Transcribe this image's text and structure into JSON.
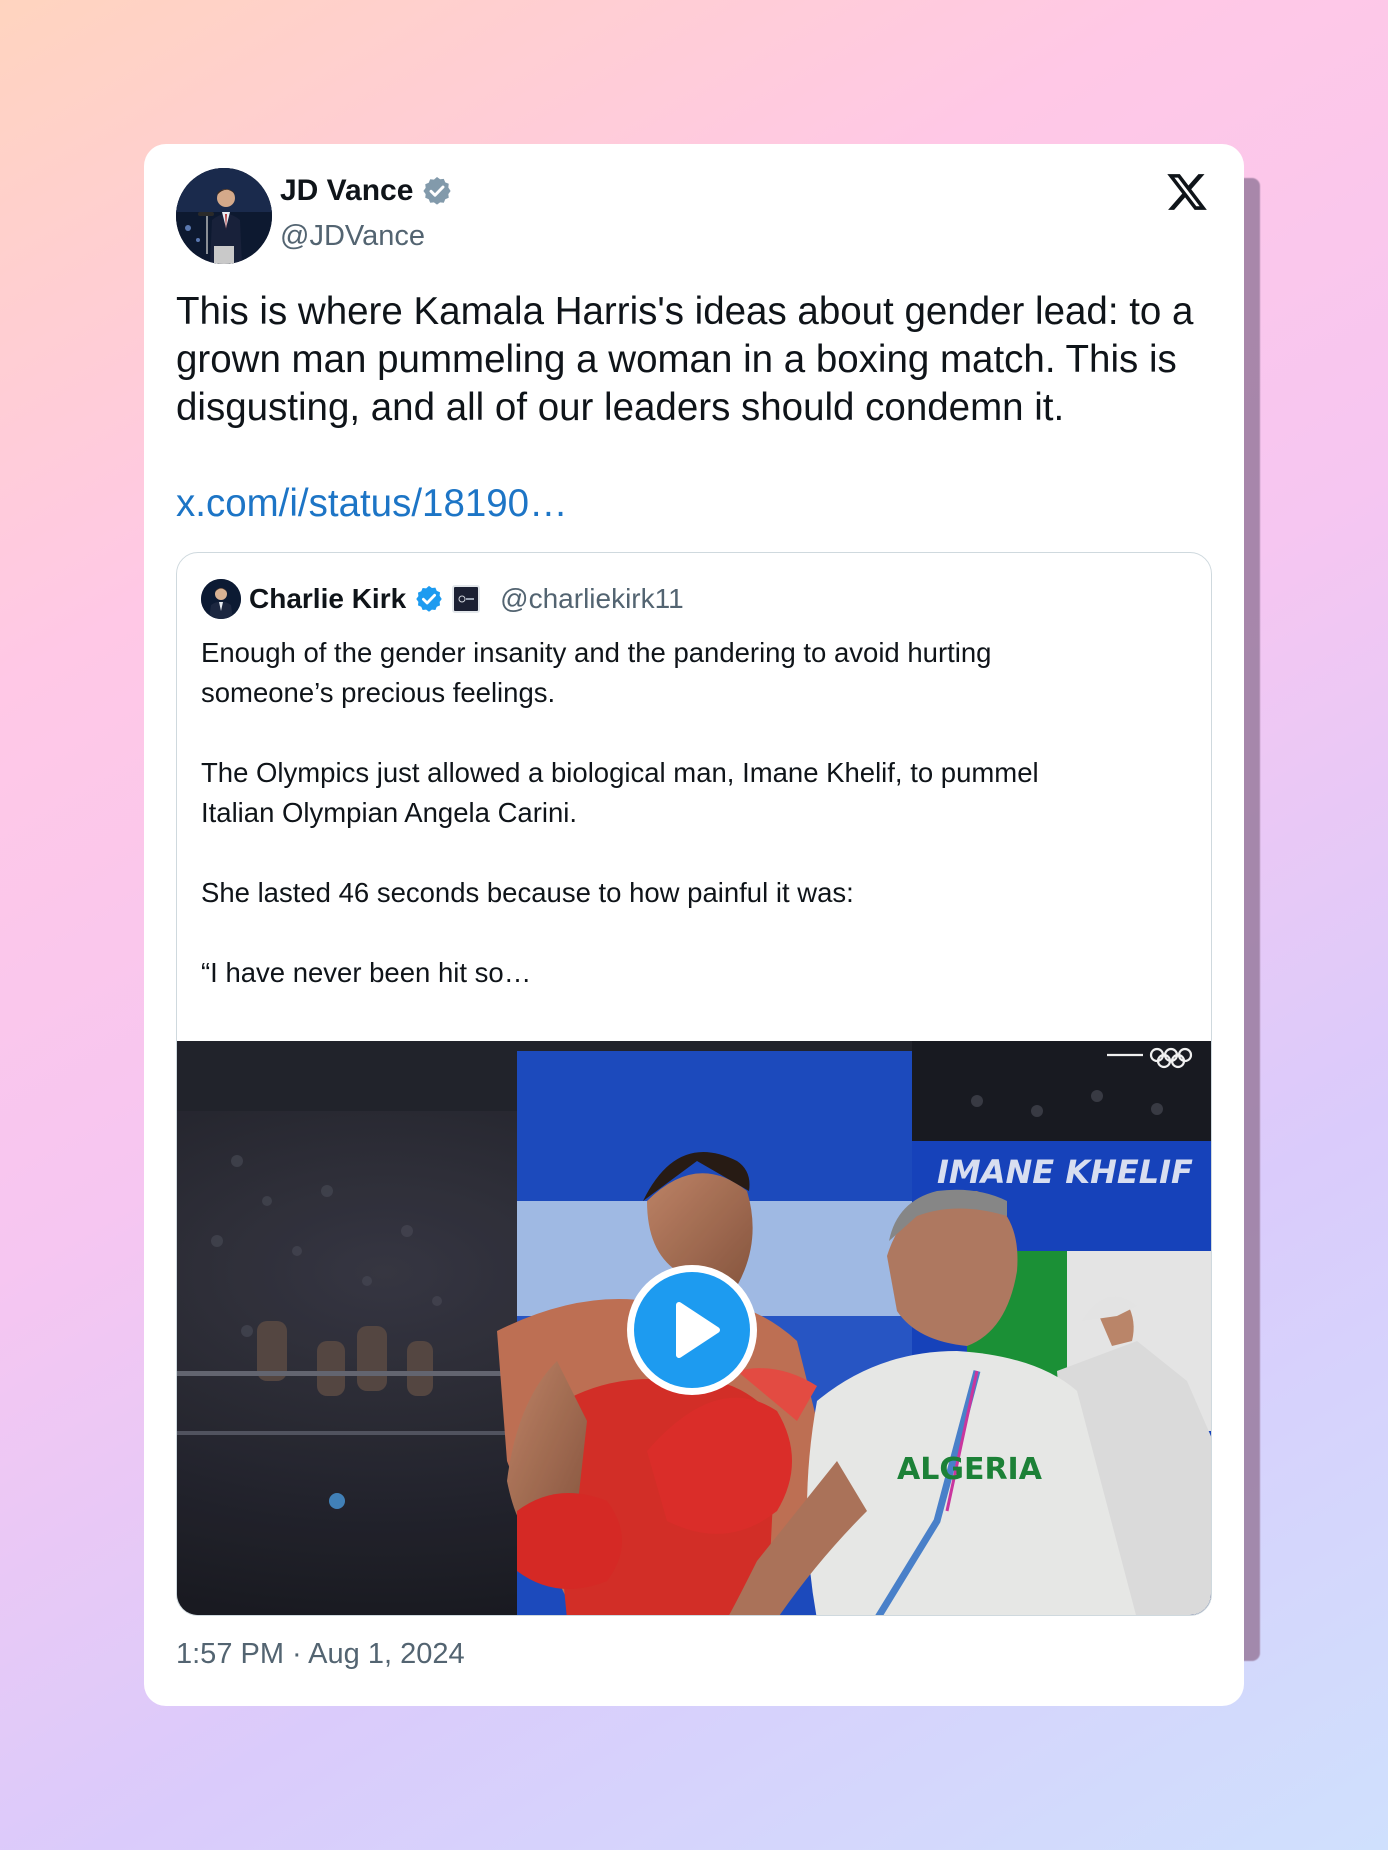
{
  "tweet": {
    "author_name": "JD Vance",
    "author_handle": "@JDVance",
    "text": "This is where Kamala Harris's ideas about gender lead: to a grown man pummeling a woman in a boxing match. This is disgusting, and all of our leaders should condemn it.",
    "link": "x.com/i/status/18190…",
    "timestamp": "1:57 PM · Aug 1, 2024"
  },
  "quoted_tweet": {
    "author_name": "Charlie Kirk",
    "author_handle": "@charliekirk11",
    "text": "Enough of the gender insanity and the pandering to avoid hurting\nsomeone’s precious feelings.\n\nThe Olympics just allowed a biological man, Imane Khelif, to pummel\nItalian Olympian Angela Carini.\n\nShe lasted 46 seconds because to how painful it was:\n\n“I have never been hit so…"
  },
  "video": {
    "banner_text": "IMANE KHELIF",
    "shirt_text": "ALGERIA"
  },
  "icons": {
    "verified_gray": "verified-gray-icon",
    "verified_blue": "verified-blue-icon",
    "platform": "x-logo-icon",
    "play": "play-icon",
    "olympic_rings": "olympic-rings-icon"
  },
  "colors": {
    "link": "#1d75c6",
    "verified_blue": "#1d9bf0",
    "verified_gray": "#829aab",
    "play_button": "#1d9bf0"
  }
}
